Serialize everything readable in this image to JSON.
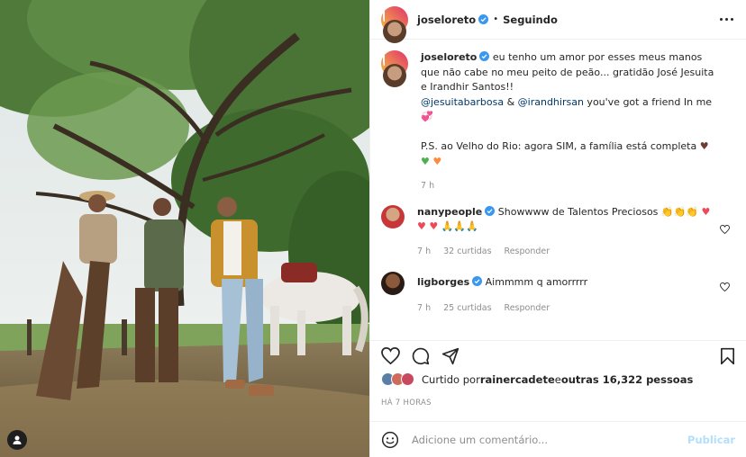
{
  "post": {
    "author": "joseloreto",
    "follow_status": "Seguindo",
    "caption": {
      "text_1": "eu tenho um amor por esses meus manos que não cabe no meu peito de peão... gratidão José Jesuita e Irandhir Santos!!",
      "mention_1": "@jesuitabarbosa",
      "amp": " & ",
      "mention_2": "@irandhirsan",
      "text_2": " you've got a friend In me",
      "emoji_1": "💞",
      "ps": "P.S. ao Velho do Rio: agora SIM, a família está completa",
      "emoji_brown": "♥",
      "emoji_green": "♥",
      "emoji_orange": "♥",
      "time": "7 h"
    }
  },
  "comments": [
    {
      "user": "nanypeople",
      "text": "Showwww de Talentos Preciosos",
      "emojis_1": "👏👏👏",
      "heart_1": "♥",
      "hearts_2": "♥ ♥",
      "pray": "🙏🙏🙏",
      "time": "7 h",
      "likes": "32 curtidas",
      "reply": "Responder"
    },
    {
      "user": "ligborges",
      "text": "Aimmmm q amorrrrr",
      "time": "7 h",
      "likes": "25 curtidas",
      "reply": "Responder"
    }
  ],
  "likes": {
    "prefix": "Curtido por ",
    "user": "rainercadete",
    "middle": " e ",
    "others": "outras 16,322 pessoas"
  },
  "time_ago": "HÁ 7 HORAS",
  "comment_box": {
    "placeholder": "Adicione um comentário...",
    "publish": "Publicar"
  },
  "colors": {
    "verified": "#3897f0",
    "link": "#00376b",
    "muted": "#8e8e8e",
    "like_red": "#ed4956"
  }
}
